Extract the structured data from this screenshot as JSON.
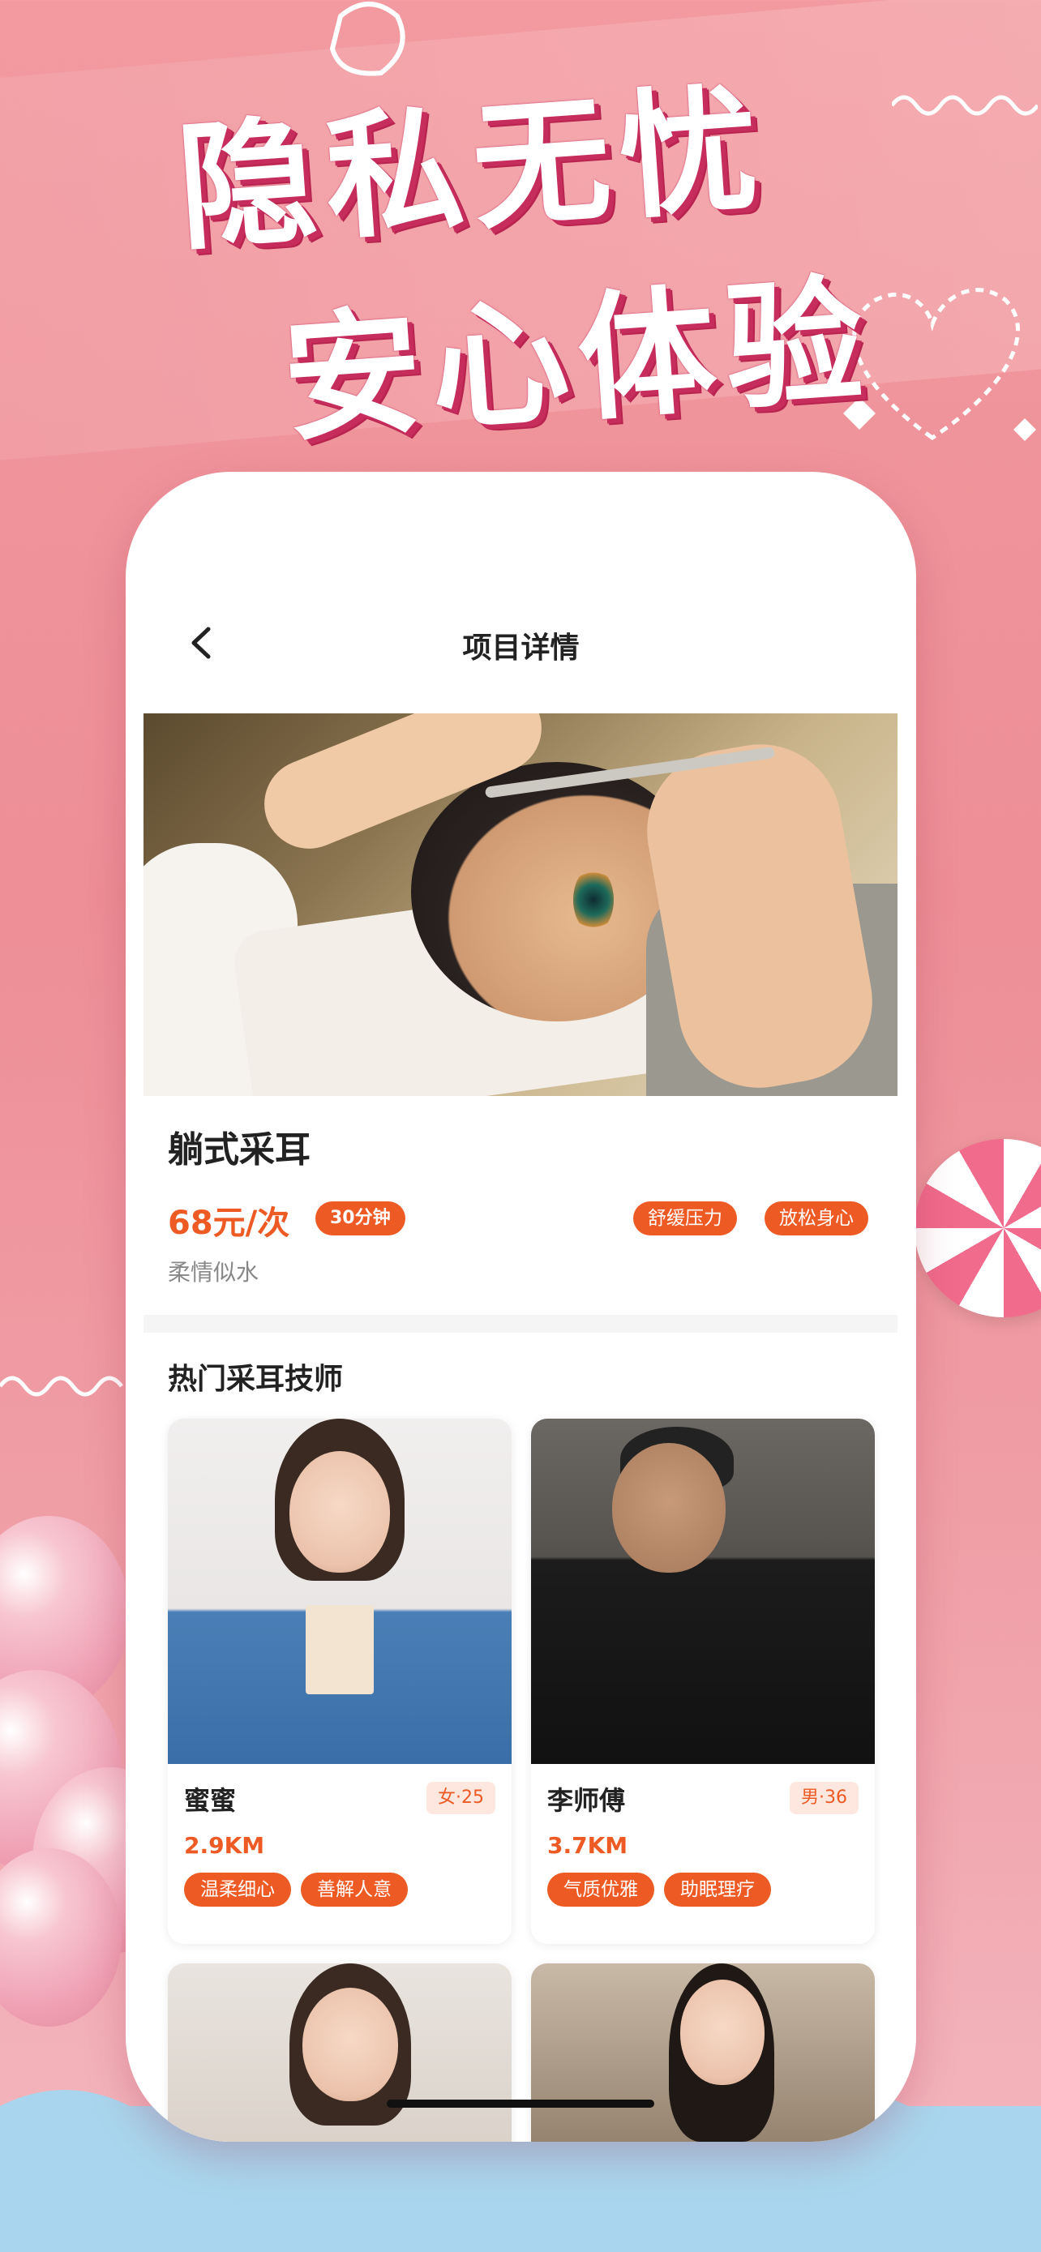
{
  "banner": {
    "line1": "隐私无忧",
    "line2": "安心体验"
  },
  "nav": {
    "title": "项目详情"
  },
  "service": {
    "name": "躺式采耳",
    "price": "68元/次",
    "duration": "30分钟",
    "tags": [
      "舒缓压力",
      "放松身心"
    ],
    "subtitle": "柔情似水"
  },
  "section": {
    "title": "热门采耳技师"
  },
  "technicians": [
    {
      "name": "蜜蜜",
      "badge": "女·25",
      "distance": "2.9KM",
      "tags": [
        "温柔细心",
        "善解人意"
      ]
    },
    {
      "name": "李师傅",
      "badge": "男·36",
      "distance": "3.7KM",
      "tags": [
        "气质优雅",
        "助眠理疗"
      ]
    }
  ],
  "colors": {
    "accent": "#ee5a24",
    "background": "#f29aa0",
    "headline_shadow": "#c62d5c"
  },
  "icons": {
    "back": "chevron-left-icon"
  }
}
